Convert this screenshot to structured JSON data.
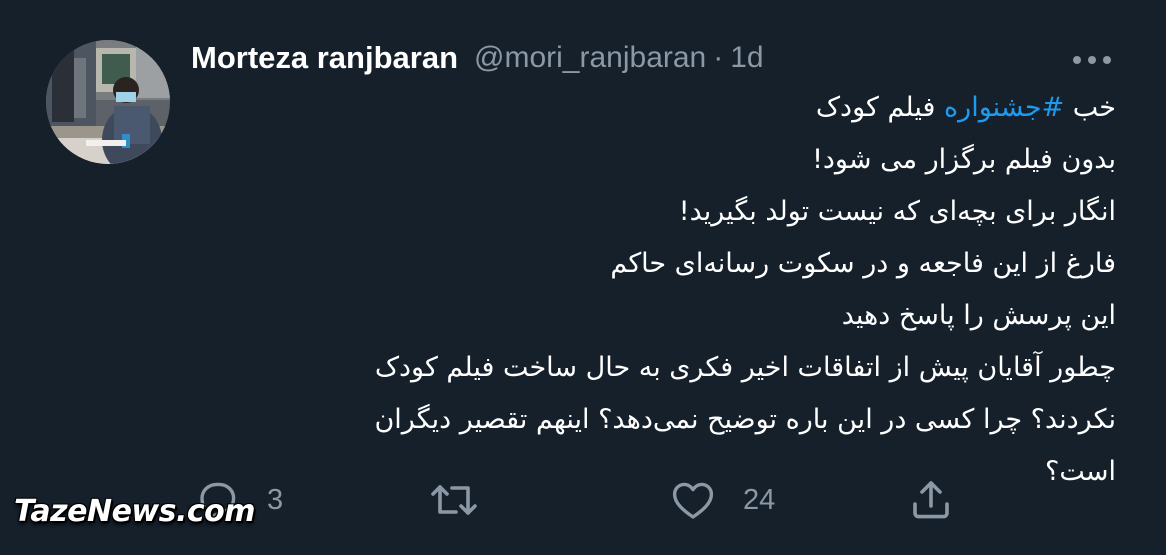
{
  "author": {
    "display_name": "Morteza ranjbaran",
    "handle": "@mori_ranjbaran",
    "separator": "·",
    "time": "1d"
  },
  "tweet": {
    "line1_prefix": "خب ",
    "line1_hashtag": "#جشنواره",
    "line1_suffix": " فیلم کودک",
    "line2": "بدون فیلم برگزار می شود!",
    "line3": "انگار برای بچه‌ای که نیست تولد بگیرید!",
    "line4": "فارغ از این فاجعه و در سکوت رسانه‌ای حاکم",
    "line5": "این پرسش را پاسخ دهید",
    "line6": "چطور آقایان پیش از اتفاقات اخیر فکری به حال ساخت فیلم کودک",
    "line7": "نکردند؟ چرا کسی در این باره توضیح نمی‌دهد؟ اینهم تقصیر دیگران",
    "line8": "است؟"
  },
  "actions": {
    "reply_count": "3",
    "retweet_count": "",
    "like_count": "24",
    "share_count": ""
  },
  "icons": [
    "more-icon",
    "reply-icon",
    "retweet-icon",
    "like-icon",
    "share-icon"
  ],
  "colors": {
    "background": "#15202b",
    "text": "#ffffff",
    "secondary": "#8b98a5",
    "link": "#1d9bf0"
  },
  "watermark": {
    "text": "TazeNews.com"
  }
}
